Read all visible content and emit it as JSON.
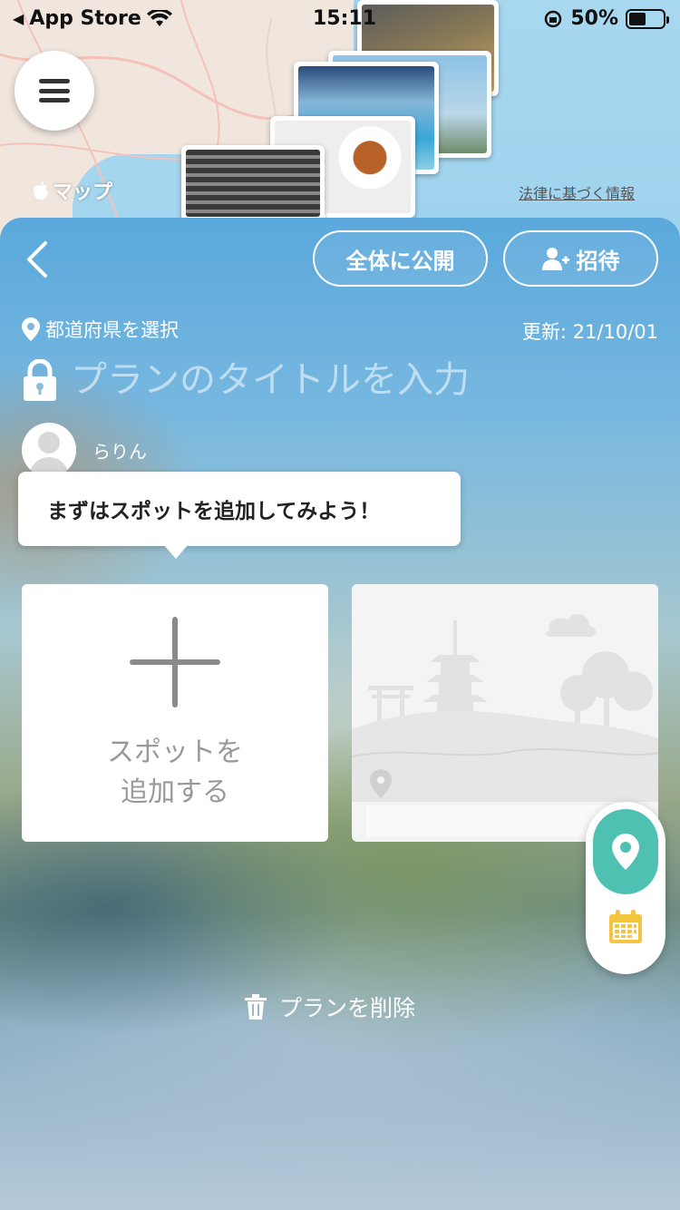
{
  "status_bar": {
    "back_app": "App Store",
    "time": "15:11",
    "battery": "50%"
  },
  "map": {
    "logo": "マップ",
    "legal": "法律に基づく情報"
  },
  "header": {
    "publish_label": "全体に公開",
    "invite_label": "招待"
  },
  "plan": {
    "prefecture_label": "都道府県を選択",
    "updated": "更新: 21/10/01",
    "title_placeholder": "プランのタイトルを入力",
    "user_name": "らりん"
  },
  "tooltip": {
    "text": "まずはスポットを追加してみよう！"
  },
  "add_spot": {
    "line1": "スポットを",
    "line2": "追加する"
  },
  "footer": {
    "delete_label": "プランを削除"
  },
  "colors": {
    "accent_teal": "#4fc1b3",
    "calendar_yellow": "#f5c542"
  },
  "icons": [
    "menu-icon",
    "back-chevron-icon",
    "add-user-icon",
    "location-pin-icon",
    "lock-icon",
    "map-pin-icon",
    "calendar-icon",
    "trash-icon",
    "plus-icon"
  ]
}
